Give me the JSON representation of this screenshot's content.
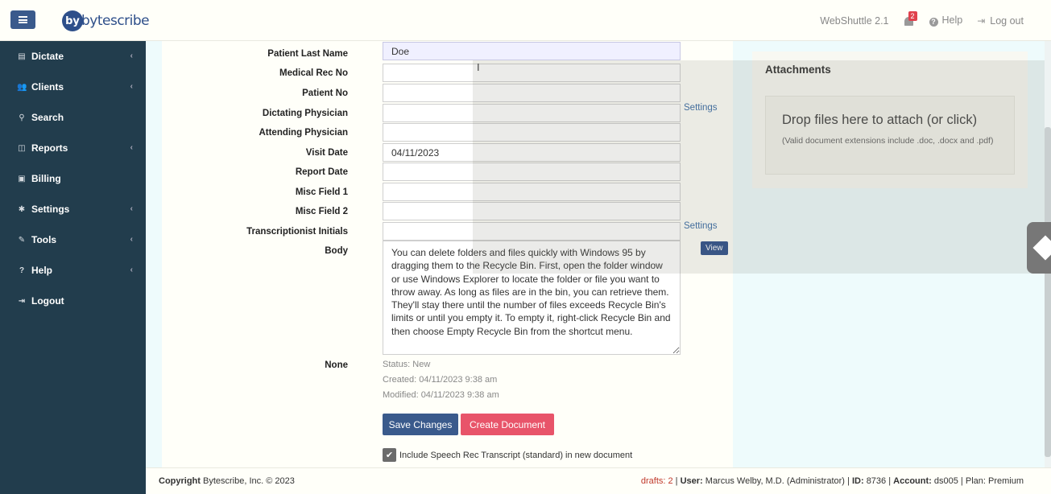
{
  "header": {
    "logo_text": "bytescribe",
    "logo_disc": "by",
    "app_version": "WebShuttle 2.1",
    "notification_count": "2",
    "help_label": "Help",
    "logout_label": "Log out"
  },
  "sidebar": {
    "items": [
      {
        "label": "Dictate",
        "icon": "file-icon",
        "glyph": "▤",
        "has_sub": true
      },
      {
        "label": "Clients",
        "icon": "users-icon",
        "glyph": "👥",
        "has_sub": true
      },
      {
        "label": "Search",
        "icon": "search-icon",
        "glyph": "⚲",
        "has_sub": false
      },
      {
        "label": "Reports",
        "icon": "reports-icon",
        "glyph": "◫",
        "has_sub": true
      },
      {
        "label": "Billing",
        "icon": "billing-icon",
        "glyph": "▣",
        "has_sub": false
      },
      {
        "label": "Settings",
        "icon": "gear-icon",
        "glyph": "✱",
        "has_sub": true
      },
      {
        "label": "Tools",
        "icon": "wrench-icon",
        "glyph": "✎",
        "has_sub": true
      },
      {
        "label": "Help",
        "icon": "help-icon",
        "glyph": "?",
        "has_sub": true
      },
      {
        "label": "Logout",
        "icon": "logout-icon",
        "glyph": "⇥",
        "has_sub": false
      }
    ]
  },
  "form": {
    "fields": [
      {
        "label": "Patient Last Name",
        "value": "Doe"
      },
      {
        "label": "Medical Rec No",
        "value": ""
      },
      {
        "label": "Patient No",
        "value": ""
      },
      {
        "label": "Dictating Physician",
        "value": ""
      },
      {
        "label": "Attending Physician",
        "value": ""
      },
      {
        "label": "Visit Date",
        "value": "04/11/2023"
      },
      {
        "label": "Report Date",
        "value": ""
      },
      {
        "label": "Misc Field 1",
        "value": ""
      },
      {
        "label": "Misc Field 2",
        "value": ""
      },
      {
        "label": "Transcriptionist Initials",
        "value": ""
      }
    ],
    "body_label": "Body",
    "body_text": "You can delete folders and files quickly with Windows 95 by dragging them to the Recycle Bin. First, open the folder window or use Windows Explorer to locate the folder or file you want to throw away. As long as files are in the bin, you can retrieve them. They'll stay there until the number of files exceeds Recycle Bin's limits or until you empty it. To empty it, right-click Recycle Bin and then choose Empty Recycle Bin from the shortcut menu.",
    "settings_label_1": "Settings",
    "settings_label_2": "Settings",
    "view_label": "View",
    "none_label": "None",
    "status": "Status: New",
    "created": "Created: 04/11/2023 9:38 am",
    "modified": "Modified: 04/11/2023 9:38 am",
    "save_label": "Save Changes",
    "create_label": "Create Document",
    "include_label": "Include Speech Rec Transcript (standard) in new document",
    "include_checked": true
  },
  "attachments": {
    "title": "Attachments",
    "drop_text": "Drop files here to attach (or click)",
    "hint": "(Valid document extensions include .doc, .docx and .pdf)"
  },
  "footer": {
    "copyright_label": "Copyright",
    "copyright_text": " Bytescribe, Inc. © 2023",
    "drafts": "drafts: 2",
    "user_label": "User:",
    "user_value": "Marcus Welby, M.D. (Administrator)",
    "id_label": "ID:",
    "id_value": "8736",
    "account_label": "Account:",
    "account_value": "ds005",
    "plan": "Plan: Premium"
  },
  "colors": {
    "sidebar_bg": "#223d4d",
    "primary": "#3a5a8c",
    "danger": "#e8546a",
    "main_bg": "#eefbfc"
  }
}
